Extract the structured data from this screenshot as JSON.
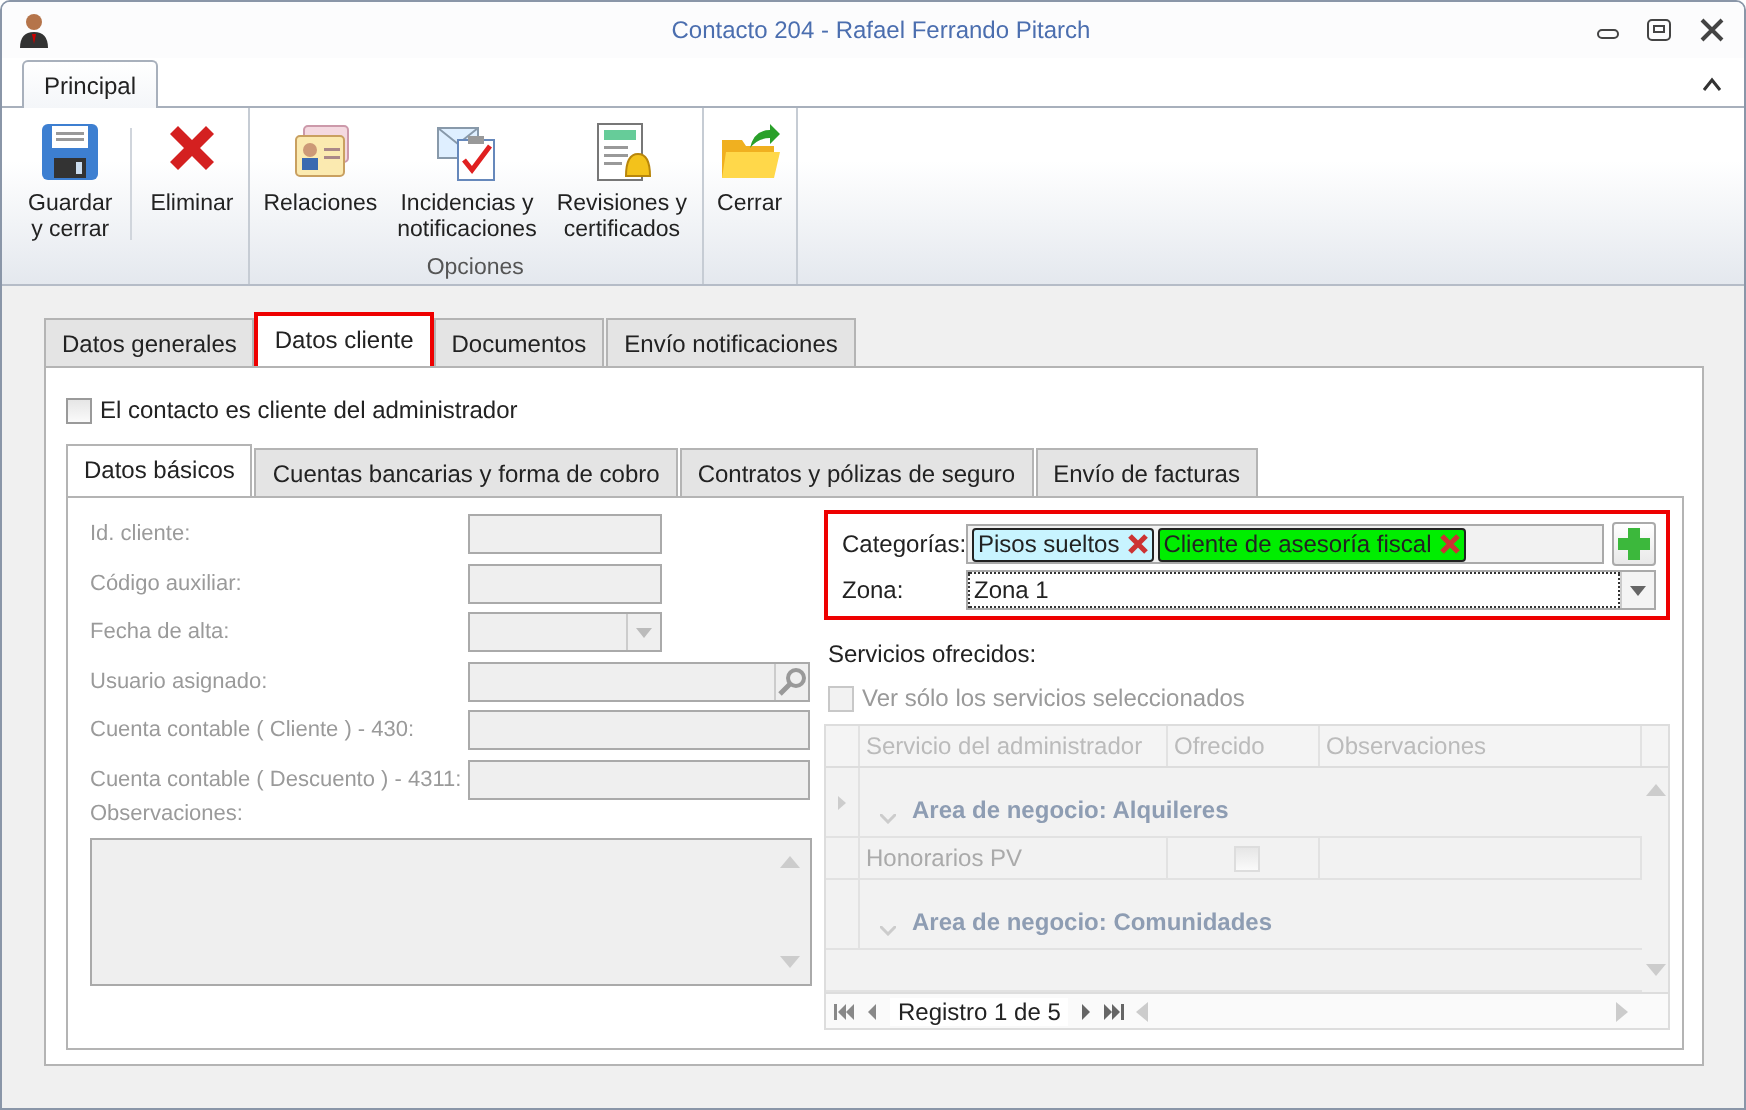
{
  "window": {
    "title": "Contacto 204 - Rafael Ferrando Pitarch"
  },
  "ribbon": {
    "tabs": [
      {
        "label": "Principal",
        "selected": true
      }
    ],
    "groups": [
      {
        "buttons": [
          {
            "kind": "save",
            "label": "Guardar\ny cerrar"
          },
          {
            "kind": "delete",
            "label": "Eliminar"
          }
        ]
      },
      {
        "label": "Opciones",
        "buttons": [
          {
            "kind": "contacts",
            "label": "Relaciones"
          },
          {
            "kind": "incidents",
            "label": "Incidencias y\nnotificaciones"
          },
          {
            "kind": "reviews",
            "label": "Revisiones y\ncertificados"
          }
        ]
      },
      {
        "buttons": [
          {
            "kind": "close",
            "label": "Cerrar"
          }
        ]
      }
    ]
  },
  "tabs": [
    {
      "label": "Datos generales",
      "selected": false,
      "highlighted": false
    },
    {
      "label": "Datos cliente",
      "selected": true,
      "highlighted": true
    },
    {
      "label": "Documentos",
      "selected": false,
      "highlighted": false
    },
    {
      "label": "Envío notificaciones",
      "selected": false,
      "highlighted": false
    }
  ],
  "client_checkbox": {
    "label": "El contacto es cliente del administrador",
    "checked": false
  },
  "subtabs": [
    {
      "label": "Datos básicos",
      "selected": true
    },
    {
      "label": "Cuentas bancarias y forma de cobro",
      "selected": false
    },
    {
      "label": "Contratos y pólizas de seguro",
      "selected": false
    },
    {
      "label": "Envío de facturas",
      "selected": false
    }
  ],
  "form": {
    "disabled": true,
    "fields": [
      {
        "kind": "text",
        "label": "Id. cliente:"
      },
      {
        "kind": "text",
        "label": "Código auxiliar:"
      },
      {
        "kind": "combo",
        "label": "Fecha de alta:"
      },
      {
        "kind": "search",
        "label": "Usuario asignado:"
      },
      {
        "kind": "wide",
        "label": "Cuenta contable ( Cliente ) - 430:"
      },
      {
        "kind": "wide",
        "label": "Cuenta contable ( Descuento ) - 4311:"
      }
    ],
    "notes_label": "Observaciones:"
  },
  "classification": {
    "highlighted": true,
    "categories_label": "Categorías:",
    "tags": [
      {
        "text": "Pisos sueltos",
        "color": "#c8f4ff"
      },
      {
        "text": "Cliente de asesoría fiscal",
        "color": "#00ee00"
      }
    ],
    "zone_label": "Zona:",
    "zone_value": "Zona 1"
  },
  "services": {
    "label": "Servicios ofrecidos:",
    "filter": {
      "label": "Ver sólo los servicios seleccionados",
      "checked": false,
      "disabled": true
    },
    "columns": [
      "Servicio del administrador",
      "Ofrecido",
      "Observaciones"
    ],
    "rows": [
      {
        "kind": "group",
        "text": "Area de negocio: Alquileres"
      },
      {
        "kind": "item",
        "text": "Honorarios PV",
        "checked": false
      },
      {
        "kind": "group",
        "text": "Area de negocio: Comunidades"
      }
    ],
    "navigator": "Registro 1 de 5"
  }
}
